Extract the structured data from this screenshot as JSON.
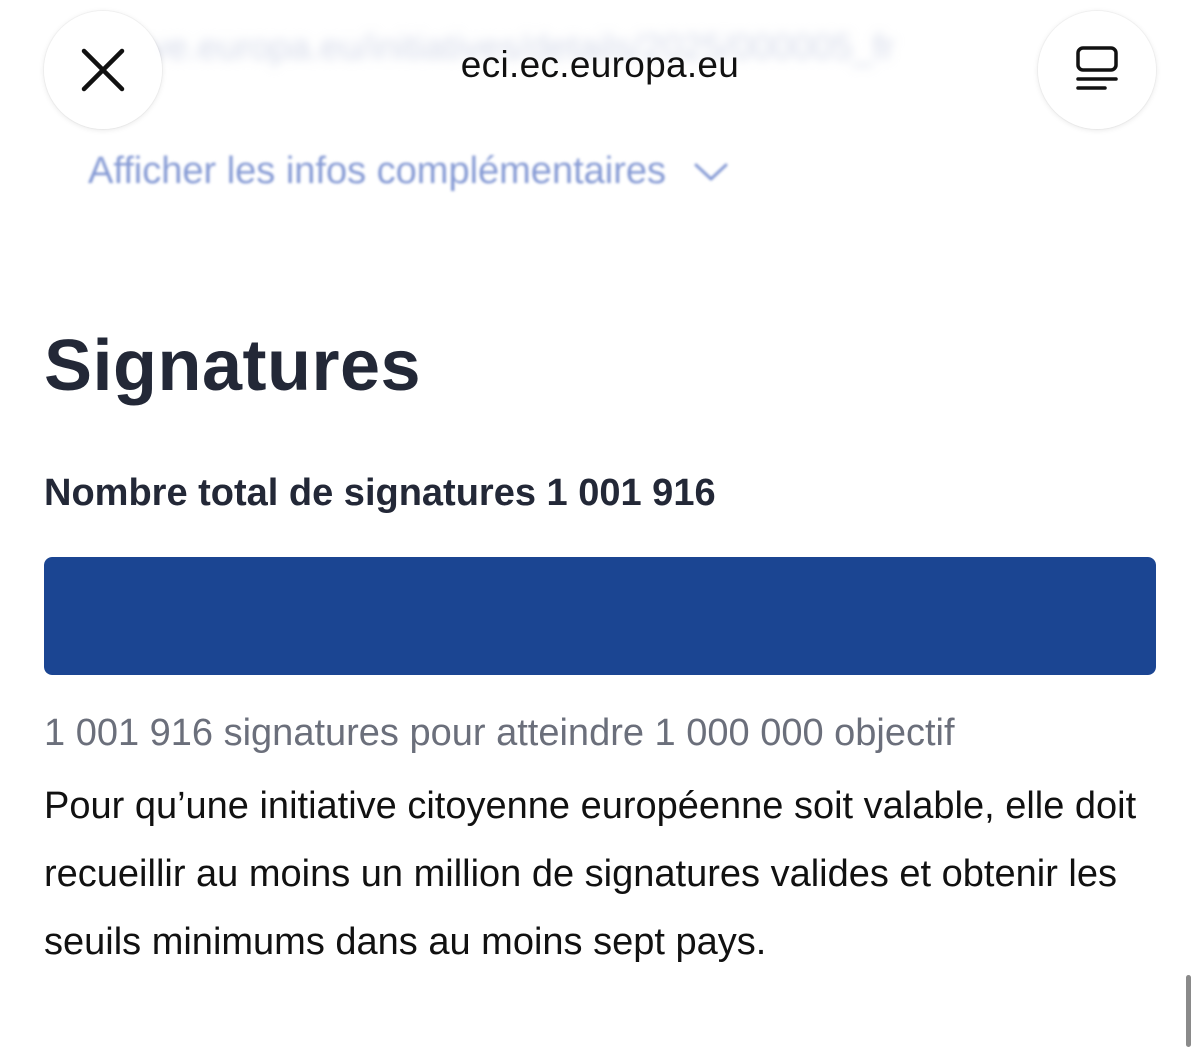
{
  "browser": {
    "domain": "eci.ec.europa.eu",
    "blurred_url": "ve.europa.eu/initiatives/details/2025/000005_fr",
    "blurred_url_prev": "",
    "close_icon": "close-icon",
    "reader_icon": "reader-mode-icon"
  },
  "page": {
    "more_info_link": "Afficher les infos complémentaires",
    "section_title": "Signatures",
    "total_label": "Nombre total de signatures 1 001 916",
    "progress_value": 1001916,
    "progress_goal": 1000000,
    "progress_fraction": 1.0,
    "progress_caption": "1 001 916 signatures pour atteindre 1 000 000 objectif",
    "description": "Pour qu’une initiative citoyenne européenne soit valable, elle doit recueillir au moins un million de signatures valides et obtenir les seuils minimums dans au moins sept pays."
  },
  "colors": {
    "progress_fill": "#1b4592",
    "link": "#6d86cc",
    "title": "#232837",
    "caption": "#6b6f7b"
  }
}
